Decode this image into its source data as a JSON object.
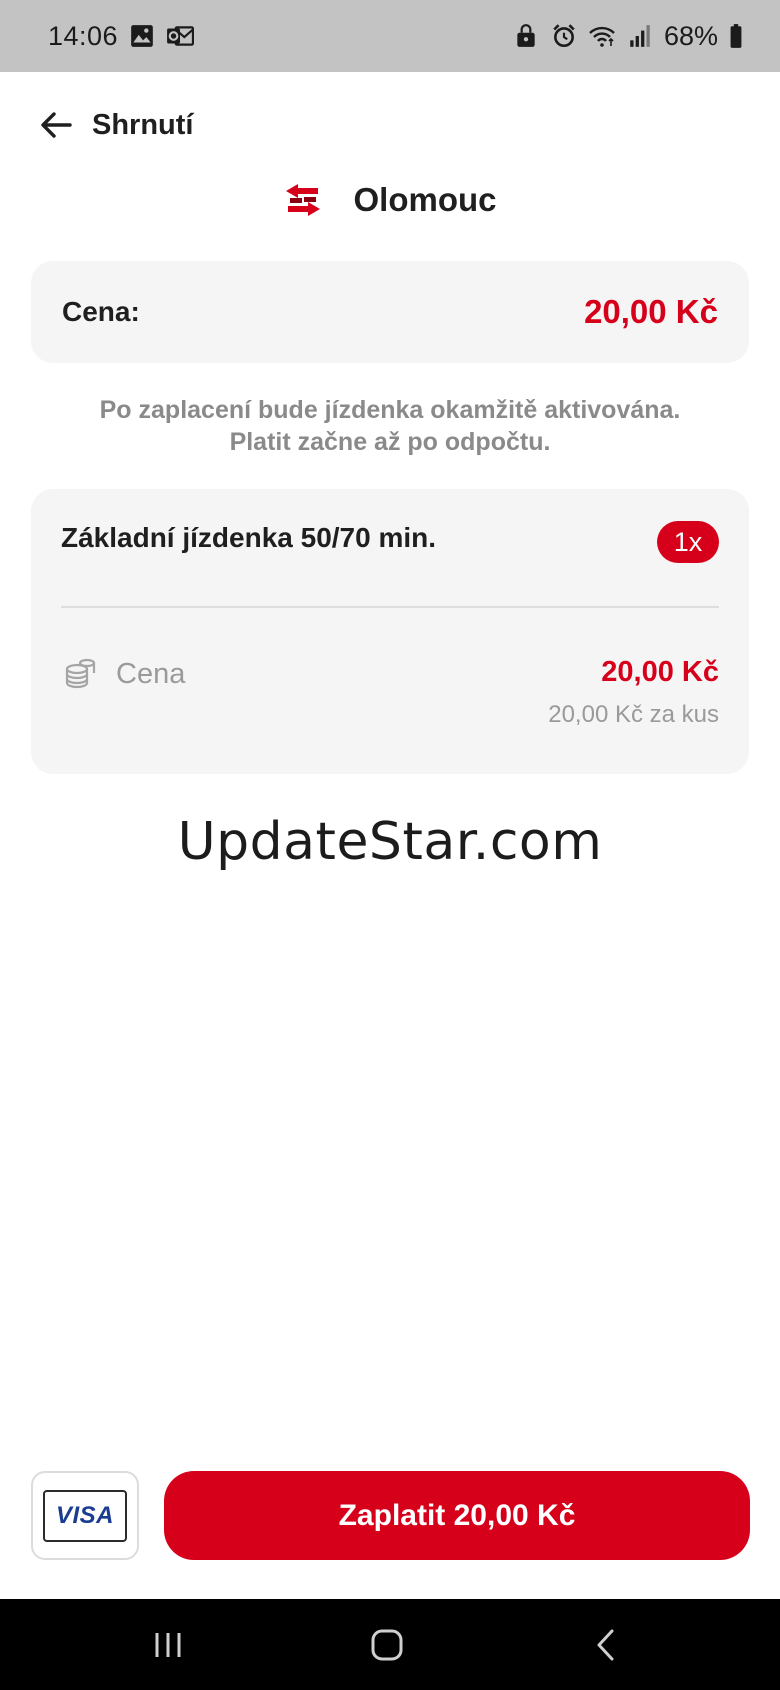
{
  "status_bar": {
    "time": "14:06",
    "battery": "68%",
    "left_icons": [
      "gallery-icon",
      "outlook-icon"
    ],
    "right_icons": [
      "lock-icon",
      "alarm-icon",
      "wifi-icon",
      "signal-icon",
      "battery-icon"
    ]
  },
  "header": {
    "title": "Shrnutí",
    "back_icon": "arrow-left-icon"
  },
  "city": {
    "name": "Olomouc",
    "logo_icon": "transit-arrows-logo"
  },
  "summary": {
    "price_label": "Cena:",
    "price_value": "20,00 Kč"
  },
  "note": {
    "line1": "Po zaplacení bude jízdenka okamžitě aktivována.",
    "line2": "Platit začne až po odpočtu."
  },
  "ticket": {
    "name": "Základní jízdenka 50/70 min.",
    "quantity": "1x",
    "price_label": "Cena",
    "price_value": "20,00 Kč",
    "unit_price": "20,00 Kč za kus",
    "price_icon": "coins-icon"
  },
  "watermark": "UpdateStar.com",
  "footer": {
    "card_brand": "VISA",
    "pay_label": "Zaplatit 20,00 Kč"
  },
  "colors": {
    "accent": "#d7001b",
    "card_bg": "#f5f5f5",
    "muted_text": "#8a8a8a",
    "status_bar_bg": "#c3c3c3"
  }
}
